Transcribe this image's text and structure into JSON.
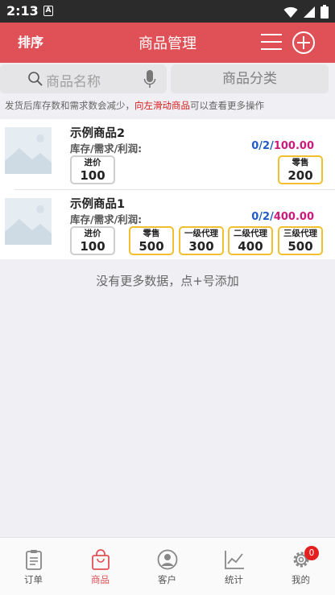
{
  "status": {
    "time": "2:13",
    "a_icon": "A"
  },
  "header": {
    "sort_label": "排序",
    "title": "商品管理"
  },
  "search": {
    "placeholder": "商品名称",
    "category_label": "商品分类"
  },
  "tip": {
    "before": "发货后库存数和需求数会减少，",
    "highlight": "向左滑动商品",
    "after": "可以查看更多操作"
  },
  "products": [
    {
      "name": "示例商品2",
      "stock_label": "库存/需求/利润:",
      "stock": "0",
      "demand": "2",
      "profit": "100.00",
      "cost": {
        "label": "进价",
        "value": "100"
      },
      "prices": [
        {
          "label": "零售",
          "value": "200"
        }
      ]
    },
    {
      "name": "示例商品1",
      "stock_label": "库存/需求/利润:",
      "stock": "0",
      "demand": "2",
      "profit": "400.00",
      "cost": {
        "label": "进价",
        "value": "100"
      },
      "prices": [
        {
          "label": "零售",
          "value": "500"
        },
        {
          "label": "一级代理",
          "value": "300"
        },
        {
          "label": "二级代理",
          "value": "400"
        },
        {
          "label": "三级代理",
          "value": "500"
        }
      ]
    }
  ],
  "no_more": "没有更多数据，点+号添加",
  "tabs": [
    {
      "label": "订单",
      "icon": "clipboard-icon"
    },
    {
      "label": "商品",
      "icon": "bag-icon",
      "active": true
    },
    {
      "label": "客户",
      "icon": "person-icon"
    },
    {
      "label": "统计",
      "icon": "chart-icon"
    },
    {
      "label": "我的",
      "icon": "gear-icon",
      "badge": "0"
    }
  ],
  "colors": {
    "accent": "#e05157",
    "price_border": "#f2c02e",
    "stock_blue": "#1f5cc9",
    "profit_pink": "#cc1a7a"
  }
}
